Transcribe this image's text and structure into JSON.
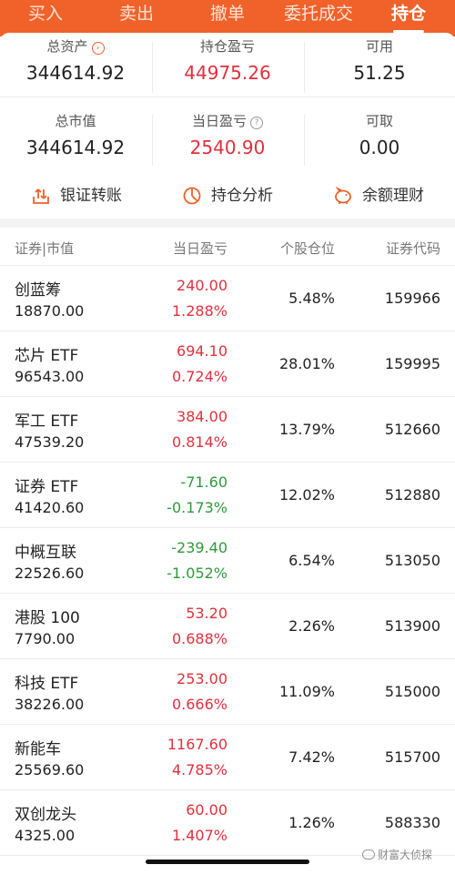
{
  "tabs": [
    {
      "label": "买入"
    },
    {
      "label": "卖出"
    },
    {
      "label": "撤单"
    },
    {
      "label": "委托成交"
    },
    {
      "label": "持仓"
    }
  ],
  "summary": {
    "total_assets_label": "总资产",
    "total_assets": "344614.92",
    "holding_pnl_label": "持仓盈亏",
    "holding_pnl": "44975.26",
    "available_label": "可用",
    "available": "51.25",
    "market_value_label": "总市值",
    "market_value": "344614.92",
    "daily_pnl_label": "当日盈亏",
    "daily_pnl": "2540.90",
    "withdrawable_label": "可取",
    "withdrawable": "0.00"
  },
  "actions": {
    "transfer": "银证转账",
    "analysis": "持仓分析",
    "wealth": "余额理财"
  },
  "table": {
    "headers": {
      "security": "证券",
      "sep": "|",
      "market_value": "市值",
      "daily_pnl": "当日盈亏",
      "position": "个股仓位",
      "code": "证券代码"
    },
    "rows": [
      {
        "name": "创蓝筹",
        "market_value": "18870.00",
        "pnl": "240.00",
        "pnl_pct": "1.288%",
        "position": "5.48%",
        "code": "159966",
        "trend": "up"
      },
      {
        "name": "芯片 ETF",
        "market_value": "96543.00",
        "pnl": "694.10",
        "pnl_pct": "0.724%",
        "position": "28.01%",
        "code": "159995",
        "trend": "up"
      },
      {
        "name": "军工 ETF",
        "market_value": "47539.20",
        "pnl": "384.00",
        "pnl_pct": "0.814%",
        "position": "13.79%",
        "code": "512660",
        "trend": "up"
      },
      {
        "name": "证券 ETF",
        "market_value": "41420.60",
        "pnl": "-71.60",
        "pnl_pct": "-0.173%",
        "position": "12.02%",
        "code": "512880",
        "trend": "down"
      },
      {
        "name": "中概互联",
        "market_value": "22526.60",
        "pnl": "-239.40",
        "pnl_pct": "-1.052%",
        "position": "6.54%",
        "code": "513050",
        "trend": "down"
      },
      {
        "name": "港股 100",
        "market_value": "7790.00",
        "pnl": "53.20",
        "pnl_pct": "0.688%",
        "position": "2.26%",
        "code": "513900",
        "trend": "up"
      },
      {
        "name": "科技 ETF",
        "market_value": "38226.00",
        "pnl": "253.00",
        "pnl_pct": "0.666%",
        "position": "11.09%",
        "code": "515000",
        "trend": "up"
      },
      {
        "name": "新能车",
        "market_value": "25569.60",
        "pnl": "1167.60",
        "pnl_pct": "4.785%",
        "position": "7.42%",
        "code": "515700",
        "trend": "up"
      },
      {
        "name": "双创龙头",
        "market_value": "4325.00",
        "pnl": "60.00",
        "pnl_pct": "1.407%",
        "position": "1.26%",
        "code": "588330",
        "trend": "up"
      }
    ]
  },
  "watermark": "财富大侦探",
  "colors": {
    "accent": "#f0622a",
    "up": "#e0313c",
    "down": "#2e9a3b"
  },
  "icons": {
    "info": "chevron-circle-icon",
    "help": "question-circle-icon",
    "transfer": "upload-transfer-icon",
    "analysis": "pie-chart-icon",
    "wealth": "piggy-bank-icon"
  }
}
